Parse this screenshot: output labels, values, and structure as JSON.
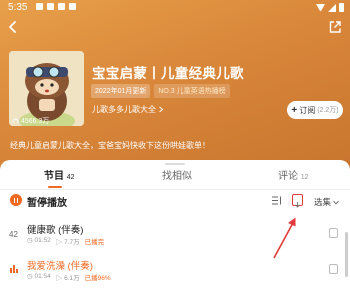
{
  "status_bar": {
    "time": "5:35"
  },
  "album": {
    "title": "宝宝启蒙丨儿童经典儿歌",
    "update_tag": "2022年01月更新",
    "rank_tag": "NO.3 儿童英语热播榜",
    "play_count": "4566.3万",
    "author": "儿歌多多儿歌大全",
    "description": "经典儿童启蒙儿歌大全，宝爸宝妈快收下这份哄娃歌单！",
    "subscribe_label": "订阅",
    "subscribe_count": "(2.2万)"
  },
  "tabs": [
    {
      "label": "节目",
      "count": "42"
    },
    {
      "label": "找相似",
      "count": ""
    },
    {
      "label": "评论",
      "count": "12"
    }
  ],
  "toolbar": {
    "status_label": "暂停播放",
    "select_label": "选集"
  },
  "tracks": [
    {
      "num": "42",
      "title": "健康歌 (伴奏)",
      "duration": "01:52",
      "plays": "7.7万",
      "progress": "已播完"
    },
    {
      "num": "",
      "title": "我爱洗澡 (伴奏)",
      "duration": "01:54",
      "plays": "6.1万",
      "progress": "已播96%"
    }
  ],
  "colors": {
    "accent": "#f06a24",
    "hero": "#d9873a",
    "annotation": "#e23b3b"
  }
}
